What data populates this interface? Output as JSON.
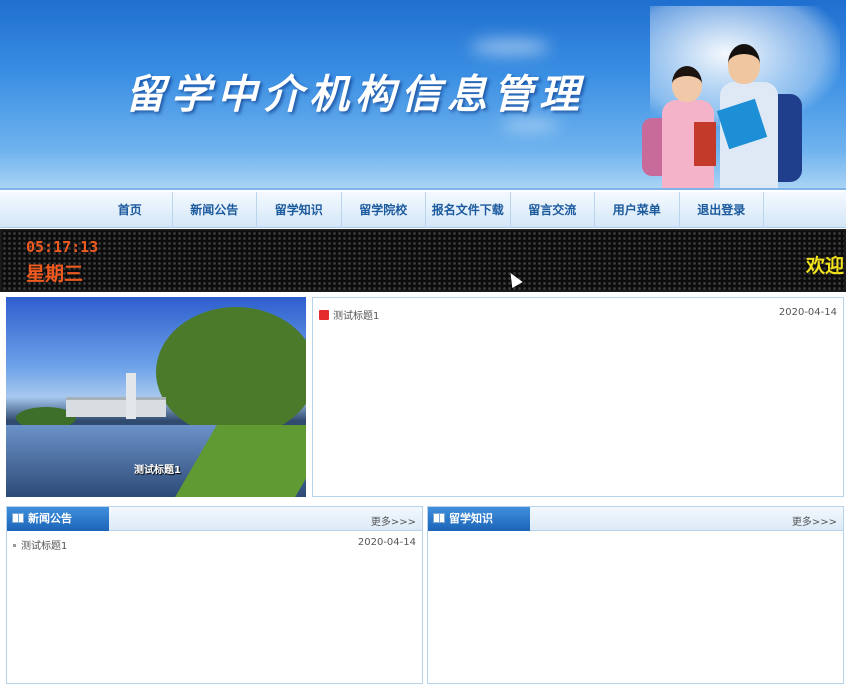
{
  "banner": {
    "title": "留学中介机构信息管理"
  },
  "nav": {
    "items": [
      "首页",
      "新闻公告",
      "留学知识",
      "留学院校",
      "报名文件下载",
      "留言交流",
      "用户菜单",
      "退出登录"
    ]
  },
  "ticker": {
    "time": "05:17:13",
    "weekday": "星期三",
    "marquee": "欢迎"
  },
  "photo": {
    "caption": "测试标题1"
  },
  "topnews": {
    "title": "测试标题1",
    "date": "2020-04-14"
  },
  "panels": {
    "news": {
      "tab": "新闻公告",
      "more": "更多>>>",
      "items": [
        {
          "title": "测试标题1",
          "date": "2020-04-14"
        }
      ]
    },
    "knowledge": {
      "tab": "留学知识",
      "more": "更多>>>"
    }
  },
  "colors": {
    "accent": "#1c64b8",
    "clock": "#f05a1e",
    "marquee": "#f2e21b"
  }
}
